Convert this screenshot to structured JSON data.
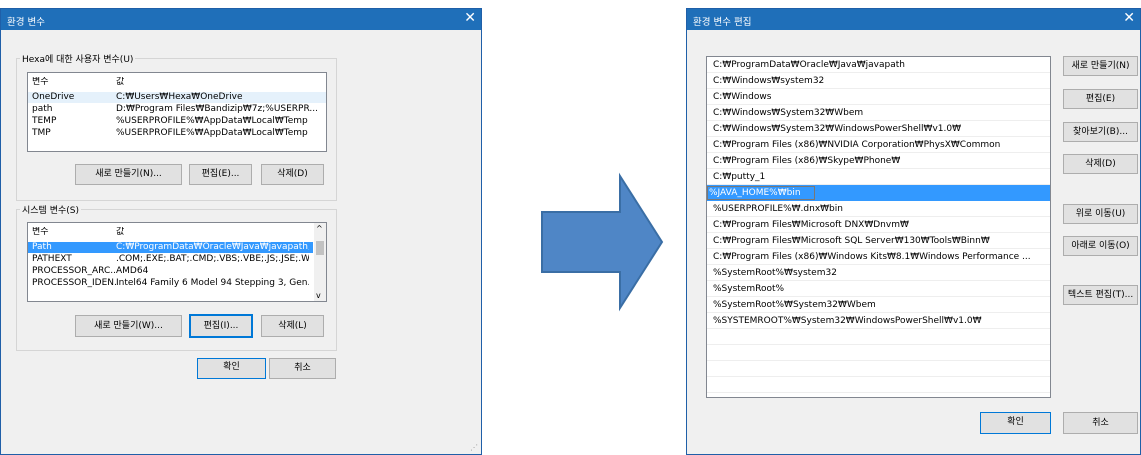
{
  "left": {
    "title": "환경 변수",
    "close": "✕",
    "user_group_label": "Hexa에 대한 사용자 변수(U)",
    "col_var": "변수",
    "col_val": "값",
    "user_vars": [
      {
        "name": "OneDrive",
        "value": "C:₩Users₩Hexa₩OneDrive"
      },
      {
        "name": "path",
        "value": "D:₩Program Files₩Bandizip₩7z;%USERPR..."
      },
      {
        "name": "TEMP",
        "value": "%USERPROFILE%₩AppData₩Local₩Temp"
      },
      {
        "name": "TMP",
        "value": "%USERPROFILE%₩AppData₩Local₩Temp"
      }
    ],
    "user_buttons": {
      "new": "새로 만들기(N)...",
      "edit": "편집(E)...",
      "delete": "삭제(D)"
    },
    "system_group_label": "시스템 변수(S)",
    "system_vars": [
      {
        "name": "Path",
        "value": "C:₩ProgramData₩Oracle₩Java₩javapath;C:..."
      },
      {
        "name": "PATHEXT",
        "value": ".COM;.EXE;.BAT;.CMD;.VBS;.VBE;.JS;.JSE;.W..."
      },
      {
        "name": "PROCESSOR_ARC...",
        "value": "AMD64"
      },
      {
        "name": "PROCESSOR_IDEN...",
        "value": "Intel64 Family 6 Model 94 Stepping 3, Gen..."
      }
    ],
    "system_buttons": {
      "new": "새로 만들기(W)...",
      "edit": "편집(I)...",
      "delete": "삭제(L)"
    },
    "ok": "확인",
    "cancel": "취소"
  },
  "right": {
    "title": "환경 변수 편집",
    "close": "✕",
    "paths": [
      "C:₩ProgramData₩Oracle₩Java₩javapath",
      "C:₩Windows₩system32",
      "C:₩Windows",
      "C:₩Windows₩System32₩Wbem",
      "C:₩Windows₩System32₩WindowsPowerShell₩v1.0₩",
      "C:₩Program Files (x86)₩NVIDIA Corporation₩PhysX₩Common",
      "C:₩Program Files (x86)₩Skype₩Phone₩",
      "C:₩putty_1",
      "%JAVA_HOME%₩bin",
      "%USERPROFILE%₩.dnx₩bin",
      "C:₩Program Files₩Microsoft DNX₩Dnvm₩",
      "C:₩Program Files₩Microsoft SQL Server₩130₩Tools₩Binn₩",
      "C:₩Program Files (x86)₩Windows Kits₩8.1₩Windows Performance ...",
      "%SystemRoot%₩system32",
      "%SystemRoot%",
      "%SystemRoot%₩System32₩Wbem",
      "%SYSTEMROOT%₩System32₩WindowsPowerShell₩v1.0₩"
    ],
    "buttons": {
      "new": "새로 만들기(N)",
      "edit": "편집(E)",
      "browse": "찾아보기(B)...",
      "delete": "삭제(D)",
      "move_up": "위로 이동(U)",
      "move_down": "아래로 이동(O)",
      "edit_text": "텍스트 편집(T)..."
    },
    "ok": "확인",
    "cancel": "취소"
  },
  "colors": {
    "titlebar": "#1f6fb9",
    "selection": "#3399ff",
    "arrow": "#4f86c6"
  },
  "arrow_icon": "right-arrow-icon"
}
